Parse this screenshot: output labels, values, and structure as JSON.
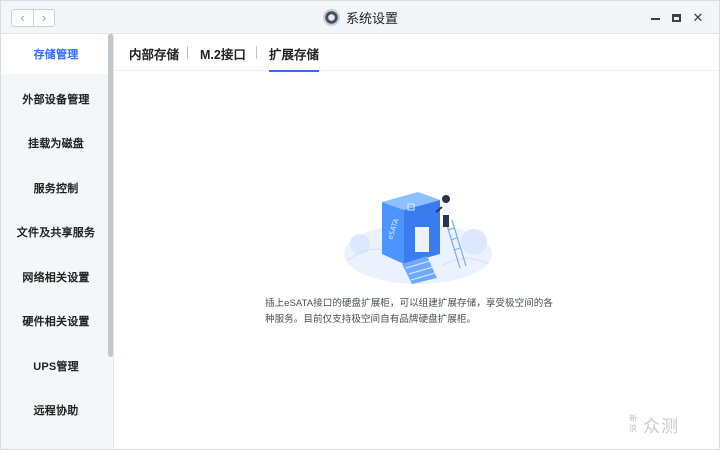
{
  "window": {
    "title": "系统设置",
    "nav_back": "‹",
    "nav_forward": "›",
    "close_symbol": "✕"
  },
  "sidebar": {
    "items": [
      {
        "label": "存储管理",
        "active": true
      },
      {
        "label": "外部设备管理",
        "active": false
      },
      {
        "label": "挂载为磁盘",
        "active": false
      },
      {
        "label": "服务控制",
        "active": false
      },
      {
        "label": "文件及共享服务",
        "active": false
      },
      {
        "label": "网络相关设置",
        "active": false
      },
      {
        "label": "硬件相关设置",
        "active": false
      },
      {
        "label": "UPS管理",
        "active": false
      },
      {
        "label": "远程协助",
        "active": false
      }
    ]
  },
  "main": {
    "tabs": [
      {
        "label": "内部存储",
        "active": false
      },
      {
        "label": "M.2接口",
        "active": false
      },
      {
        "label": "扩展存储",
        "active": true
      }
    ],
    "illustration_label": "eSATA",
    "description_line1": "插上eSATA接口的硬盘扩展柜，可以组建扩展存储，享受极空间的各",
    "description_line2": "种服务。目前仅支持极空间自有品牌硬盘扩展柜。"
  },
  "watermark": {
    "vertical": "新浪",
    "text": "众测"
  },
  "colors": {
    "accent": "#2f6bff",
    "sidebar_bg": "#f4f6f9",
    "titlebar_bg": "#f3f5f8"
  }
}
